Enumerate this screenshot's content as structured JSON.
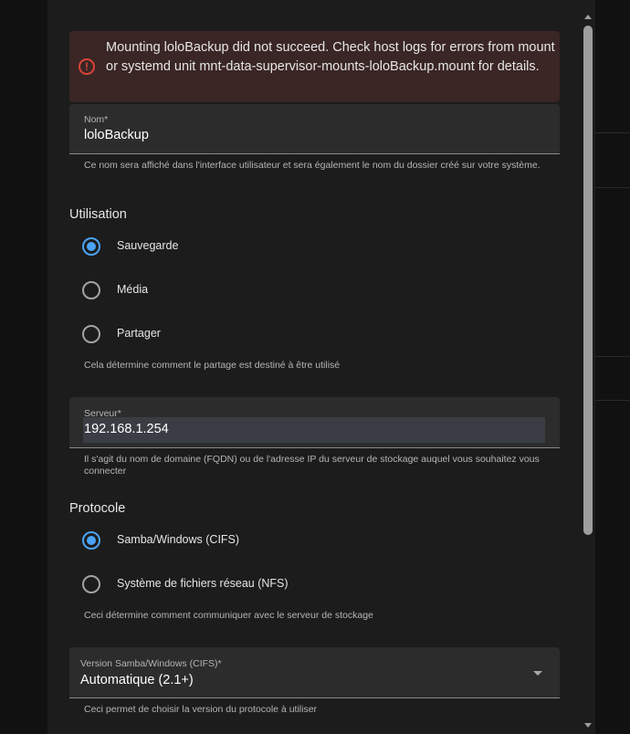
{
  "alert": {
    "icon": "error-circle-icon",
    "message": "Mounting loloBackup did not succeed. Check host logs for errors from mount or systemd unit mnt-data-supervisor-mounts-loloBackup.mount for details.",
    "color": "#db4437"
  },
  "name_field": {
    "label": "Nom*",
    "value": "loloBackup",
    "helper": "Ce nom sera affiché dans l'interface utilisateur et sera également le nom du dossier créé sur votre système."
  },
  "usage": {
    "title": "Utilisation",
    "options": [
      {
        "label": "Sauvegarde",
        "checked": true
      },
      {
        "label": "Média",
        "checked": false
      },
      {
        "label": "Partager",
        "checked": false
      }
    ],
    "helper": "Cela détermine comment le partage est destiné à être utilisé"
  },
  "server_field": {
    "label": "Serveur*",
    "value": "192.168.1.254",
    "helper": "Il s'agit du nom de domaine (FQDN) ou de l'adresse IP du serveur de stockage auquel vous souhaitez vous connecter"
  },
  "protocol": {
    "title": "Protocole",
    "options": [
      {
        "label": "Samba/Windows (CIFS)",
        "checked": true
      },
      {
        "label": "Système de fichiers réseau (NFS)",
        "checked": false
      }
    ],
    "helper": "Ceci détermine comment communiquer avec le serveur de stockage"
  },
  "version_field": {
    "label": "Version Samba/Windows (CIFS)*",
    "value": "Automatique (2.1+)",
    "helper": "Ceci permet de choisir la version du protocole à utiliser"
  },
  "colors": {
    "accent": "#4aa3f5",
    "error": "#db4437",
    "dialog_bg": "#1c1c1c",
    "field_bg": "#2c2c2c"
  }
}
